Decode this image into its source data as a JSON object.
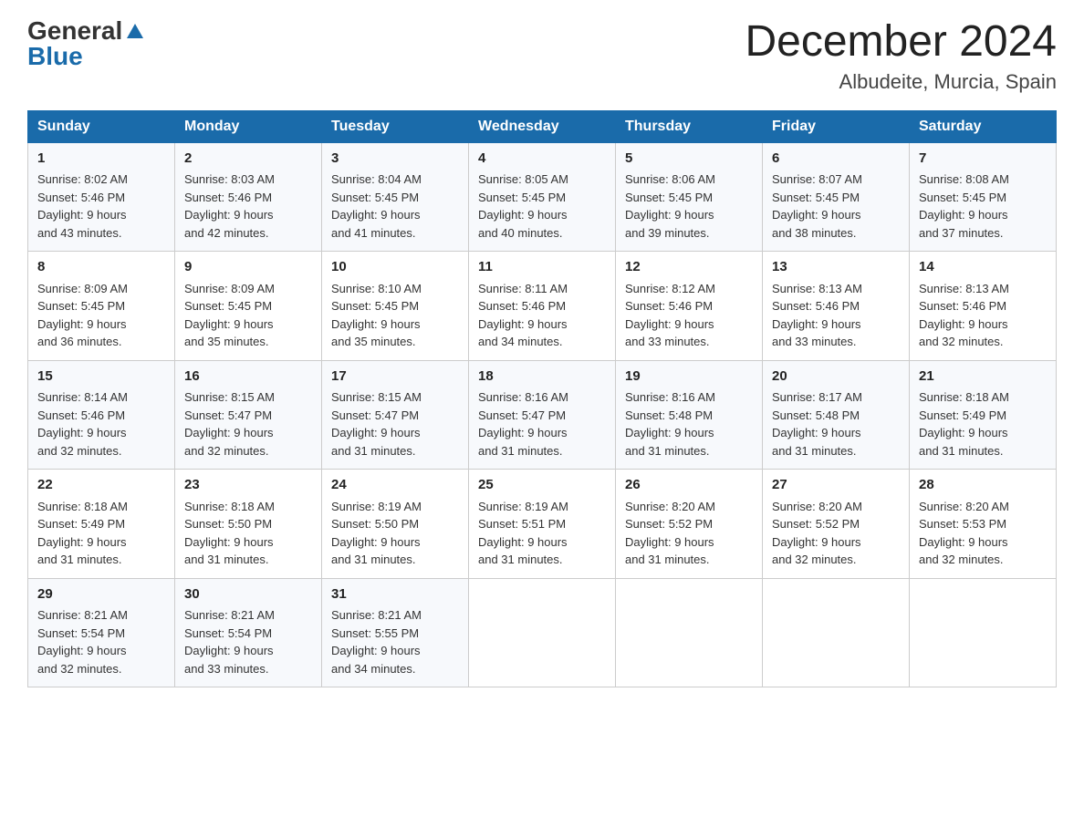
{
  "header": {
    "logo": {
      "general": "General",
      "blue": "Blue",
      "triangle": "▲"
    },
    "title": "December 2024",
    "location": "Albudeite, Murcia, Spain"
  },
  "days_of_week": [
    "Sunday",
    "Monday",
    "Tuesday",
    "Wednesday",
    "Thursday",
    "Friday",
    "Saturday"
  ],
  "weeks": [
    [
      {
        "day": "1",
        "sunrise": "8:02 AM",
        "sunset": "5:46 PM",
        "daylight": "9 hours and 43 minutes."
      },
      {
        "day": "2",
        "sunrise": "8:03 AM",
        "sunset": "5:46 PM",
        "daylight": "9 hours and 42 minutes."
      },
      {
        "day": "3",
        "sunrise": "8:04 AM",
        "sunset": "5:45 PM",
        "daylight": "9 hours and 41 minutes."
      },
      {
        "day": "4",
        "sunrise": "8:05 AM",
        "sunset": "5:45 PM",
        "daylight": "9 hours and 40 minutes."
      },
      {
        "day": "5",
        "sunrise": "8:06 AM",
        "sunset": "5:45 PM",
        "daylight": "9 hours and 39 minutes."
      },
      {
        "day": "6",
        "sunrise": "8:07 AM",
        "sunset": "5:45 PM",
        "daylight": "9 hours and 38 minutes."
      },
      {
        "day": "7",
        "sunrise": "8:08 AM",
        "sunset": "5:45 PM",
        "daylight": "9 hours and 37 minutes."
      }
    ],
    [
      {
        "day": "8",
        "sunrise": "8:09 AM",
        "sunset": "5:45 PM",
        "daylight": "9 hours and 36 minutes."
      },
      {
        "day": "9",
        "sunrise": "8:09 AM",
        "sunset": "5:45 PM",
        "daylight": "9 hours and 35 minutes."
      },
      {
        "day": "10",
        "sunrise": "8:10 AM",
        "sunset": "5:45 PM",
        "daylight": "9 hours and 35 minutes."
      },
      {
        "day": "11",
        "sunrise": "8:11 AM",
        "sunset": "5:46 PM",
        "daylight": "9 hours and 34 minutes."
      },
      {
        "day": "12",
        "sunrise": "8:12 AM",
        "sunset": "5:46 PM",
        "daylight": "9 hours and 33 minutes."
      },
      {
        "day": "13",
        "sunrise": "8:13 AM",
        "sunset": "5:46 PM",
        "daylight": "9 hours and 33 minutes."
      },
      {
        "day": "14",
        "sunrise": "8:13 AM",
        "sunset": "5:46 PM",
        "daylight": "9 hours and 32 minutes."
      }
    ],
    [
      {
        "day": "15",
        "sunrise": "8:14 AM",
        "sunset": "5:46 PM",
        "daylight": "9 hours and 32 minutes."
      },
      {
        "day": "16",
        "sunrise": "8:15 AM",
        "sunset": "5:47 PM",
        "daylight": "9 hours and 32 minutes."
      },
      {
        "day": "17",
        "sunrise": "8:15 AM",
        "sunset": "5:47 PM",
        "daylight": "9 hours and 31 minutes."
      },
      {
        "day": "18",
        "sunrise": "8:16 AM",
        "sunset": "5:47 PM",
        "daylight": "9 hours and 31 minutes."
      },
      {
        "day": "19",
        "sunrise": "8:16 AM",
        "sunset": "5:48 PM",
        "daylight": "9 hours and 31 minutes."
      },
      {
        "day": "20",
        "sunrise": "8:17 AM",
        "sunset": "5:48 PM",
        "daylight": "9 hours and 31 minutes."
      },
      {
        "day": "21",
        "sunrise": "8:18 AM",
        "sunset": "5:49 PM",
        "daylight": "9 hours and 31 minutes."
      }
    ],
    [
      {
        "day": "22",
        "sunrise": "8:18 AM",
        "sunset": "5:49 PM",
        "daylight": "9 hours and 31 minutes."
      },
      {
        "day": "23",
        "sunrise": "8:18 AM",
        "sunset": "5:50 PM",
        "daylight": "9 hours and 31 minutes."
      },
      {
        "day": "24",
        "sunrise": "8:19 AM",
        "sunset": "5:50 PM",
        "daylight": "9 hours and 31 minutes."
      },
      {
        "day": "25",
        "sunrise": "8:19 AM",
        "sunset": "5:51 PM",
        "daylight": "9 hours and 31 minutes."
      },
      {
        "day": "26",
        "sunrise": "8:20 AM",
        "sunset": "5:52 PM",
        "daylight": "9 hours and 31 minutes."
      },
      {
        "day": "27",
        "sunrise": "8:20 AM",
        "sunset": "5:52 PM",
        "daylight": "9 hours and 32 minutes."
      },
      {
        "day": "28",
        "sunrise": "8:20 AM",
        "sunset": "5:53 PM",
        "daylight": "9 hours and 32 minutes."
      }
    ],
    [
      {
        "day": "29",
        "sunrise": "8:21 AM",
        "sunset": "5:54 PM",
        "daylight": "9 hours and 32 minutes."
      },
      {
        "day": "30",
        "sunrise": "8:21 AM",
        "sunset": "5:54 PM",
        "daylight": "9 hours and 33 minutes."
      },
      {
        "day": "31",
        "sunrise": "8:21 AM",
        "sunset": "5:55 PM",
        "daylight": "9 hours and 34 minutes."
      },
      null,
      null,
      null,
      null
    ]
  ]
}
